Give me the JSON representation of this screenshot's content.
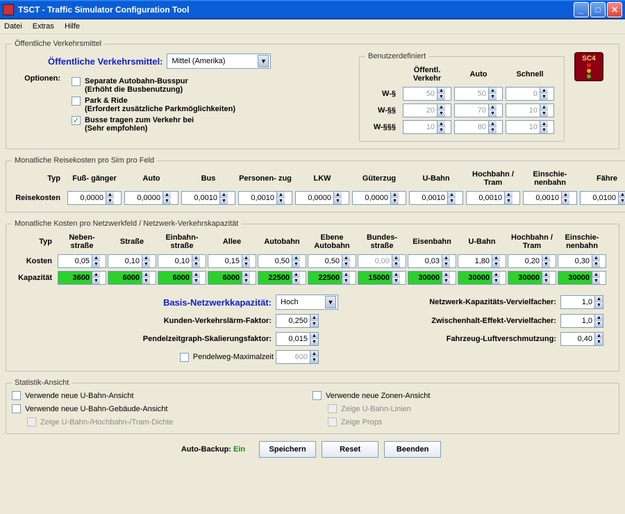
{
  "window": {
    "title": "TSCT - Traffic Simulator Configuration Tool"
  },
  "menu": {
    "file": "Datei",
    "extras": "Extras",
    "help": "Hilfe"
  },
  "transit": {
    "legend": "Öffentliche Verkehrsmittel",
    "label": "Öffentliche Verkehrsmittel:",
    "preset": "Mittel (Amerika)",
    "options_label": "Optionen:",
    "opt1": "Separate Autobahn-Busspur",
    "opt1_sub": "(Erhöht die Busbenutzung)",
    "opt2": "Park & Ride",
    "opt2_sub": "(Erfordert zusätzliche Parkmöglichkeiten)",
    "opt3": "Busse tragen zum Verkehr bei",
    "opt3_sub": "(Sehr empfohlen)"
  },
  "custom": {
    "legend": "Benutzerdefiniert",
    "col_transit": "Öffentl.\nVerkehr",
    "col_auto": "Auto",
    "col_fast": "Schnell",
    "rows": [
      {
        "label": "W-§",
        "transit": "50",
        "auto": "50",
        "fast": "0"
      },
      {
        "label": "W-§§",
        "transit": "20",
        "auto": "70",
        "fast": "10"
      },
      {
        "label": "W-§§§",
        "transit": "10",
        "auto": "80",
        "fast": "10"
      }
    ]
  },
  "logo": "SC4",
  "travel": {
    "legend": "Monatliche Reisekosten pro Sim pro Feld",
    "type_label": "Typ",
    "cost_label": "Reisekosten",
    "cols": [
      "Fuß-\ngänger",
      "Auto",
      "Bus",
      "Personen-\nzug",
      "LKW",
      "Güterzug",
      "U-Bahn",
      "Hochbahn\n/ Tram",
      "Einschie-\nnenbahn",
      "Fähre"
    ],
    "vals": [
      "0,0000",
      "0,0000",
      "0,0010",
      "0,0010",
      "0,0000",
      "0,0000",
      "0,0010",
      "0,0010",
      "0,0010",
      "0,0100"
    ]
  },
  "network": {
    "legend": "Monatliche Kosten pro Netzwerkfeld / Netzwerk-Verkehrskapazität",
    "type_label": "Typ",
    "cost_label": "Kosten",
    "cap_label": "Kapazität",
    "cols": [
      "Neben-\nstraße",
      "Straße",
      "Einbahn-\nstraße",
      "Allee",
      "Autobahn",
      "Ebene\nAutobahn",
      "Bundes-\nstraße",
      "Eisenbahn",
      "U-Bahn",
      "Hochbahn\n/ Tram",
      "Einschie-\nnenbahn"
    ],
    "costs": [
      "0,05",
      "0,10",
      "0,10",
      "0,15",
      "0,50",
      "0,50",
      "0,00",
      "0,03",
      "1,80",
      "0,20",
      "0,30"
    ],
    "caps": [
      "3600",
      "6000",
      "6000",
      "6000",
      "22500",
      "22500",
      "15000",
      "30000",
      "30000",
      "30000",
      "30000"
    ]
  },
  "tuning": {
    "base_label": "Basis-Netzwerkkapazität:",
    "base_value": "Hoch",
    "noise_label": "Kunden-Verkehrslärm-Faktor:",
    "noise_value": "0,250",
    "graph_label": "Pendelzeitgraph-Skalierungsfaktor:",
    "graph_value": "0,015",
    "maxtime_label": "Pendelweg-Maximalzeit",
    "maxtime_value": "600",
    "mult_label": "Netzwerk-Kapazitäts-Vervielfacher:",
    "mult_value": "1,0",
    "inter_label": "Zwischenhalt-Effekt-Vervielfacher:",
    "inter_value": "1,0",
    "pollute_label": "Fahrzeug-Luftverschmutzung:",
    "pollute_value": "0,40"
  },
  "stats": {
    "legend": "Statistik-Ansicht",
    "subway": "Verwende neue U-Bahn-Ansicht",
    "subway_bldg": "Verwende neue U-Bahn-Gebäude-Ansicht",
    "density": "Zeige U-Bahn-/Hochbahn-/Tram-Dichte",
    "zones": "Verwende neue Zonen-Ansicht",
    "lines": "Zeige U-Bahn-Linien",
    "props": "Zeige Props"
  },
  "footer": {
    "autobk_label": "Auto-Backup:",
    "autobk_value": "Ein",
    "save": "Speichern",
    "reset": "Reset",
    "quit": "Beenden"
  }
}
